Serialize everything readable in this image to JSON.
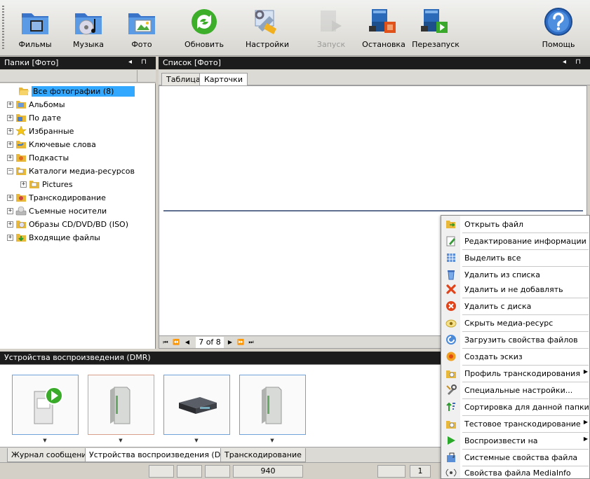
{
  "toolbar": {
    "films": "Фильмы",
    "music": "Музыка",
    "photo": "Фото",
    "refresh": "Обновить",
    "settings": "Настройки",
    "start": "Запуск",
    "stop": "Остановка",
    "restart": "Перезапуск",
    "help": "Помощь"
  },
  "folders_panel": {
    "title": "Папки [Фото]",
    "pin_glyphs": "◂ ⊓",
    "tree": [
      {
        "label": "Все фотографии (8)"
      },
      {
        "label": "Альбомы"
      },
      {
        "label": "По дате"
      },
      {
        "label": "Избранные"
      },
      {
        "label": "Ключевые слова"
      },
      {
        "label": "Подкасты"
      },
      {
        "label": "Каталоги медиа-ресурсов"
      },
      {
        "label": "Pictures"
      },
      {
        "label": "Транскодирование"
      },
      {
        "label": "Съемные носители"
      },
      {
        "label": "Образы CD/DVD/BD (ISO)"
      },
      {
        "label": "Входящие файлы"
      }
    ]
  },
  "list_panel": {
    "title": "Список [Фото]",
    "pin_glyphs": "◂ ⊓",
    "tabs": [
      {
        "label": "Таблица"
      },
      {
        "label": "Карточки"
      }
    ],
    "pager_text": "7 of 8"
  },
  "devices_panel": {
    "title": "Устройства воспроизведения (DMR)"
  },
  "bottom_tabs": [
    {
      "label": "Журнал сообщений"
    },
    {
      "label": "Устройства воспроизведения (DMR)"
    },
    {
      "label": "Транскодирование"
    }
  ],
  "status": {
    "value": "940",
    "page": "1"
  },
  "context_menu": [
    {
      "label": "Открыть файл",
      "icon": "open-file-icon"
    },
    {
      "label": "Редактирование информации",
      "icon": "edit-info-icon"
    },
    {
      "label": "Выделить все",
      "icon": "select-all-icon"
    },
    {
      "label": "Удалить из списка",
      "icon": "remove-from-list-icon"
    },
    {
      "label": "Удалить и не добавлять",
      "icon": "remove-no-add-icon"
    },
    {
      "label": "Удалить с диска",
      "icon": "delete-from-disk-icon"
    },
    {
      "label": "Скрыть медиа-ресурс",
      "icon": "hide-resource-icon"
    },
    {
      "label": "Загрузить свойства файлов",
      "icon": "load-properties-icon"
    },
    {
      "label": "Создать эскиз",
      "icon": "create-thumbnail-icon"
    },
    {
      "label": "Профиль транскодирования",
      "icon": "transcode-profile-icon"
    },
    {
      "label": "Специальные настройки...",
      "icon": "special-settings-icon"
    },
    {
      "label": "Сортировка для данной папки",
      "icon": "sort-folder-icon"
    },
    {
      "label": "Тестовое транскодирование",
      "icon": "test-transcode-icon"
    },
    {
      "label": "Воспроизвести на",
      "icon": "play-on-icon"
    },
    {
      "label": "Системные свойства файла",
      "icon": "system-properties-icon"
    },
    {
      "label": "Свойства файла MediaInfo",
      "icon": "mediainfo-icon"
    }
  ]
}
